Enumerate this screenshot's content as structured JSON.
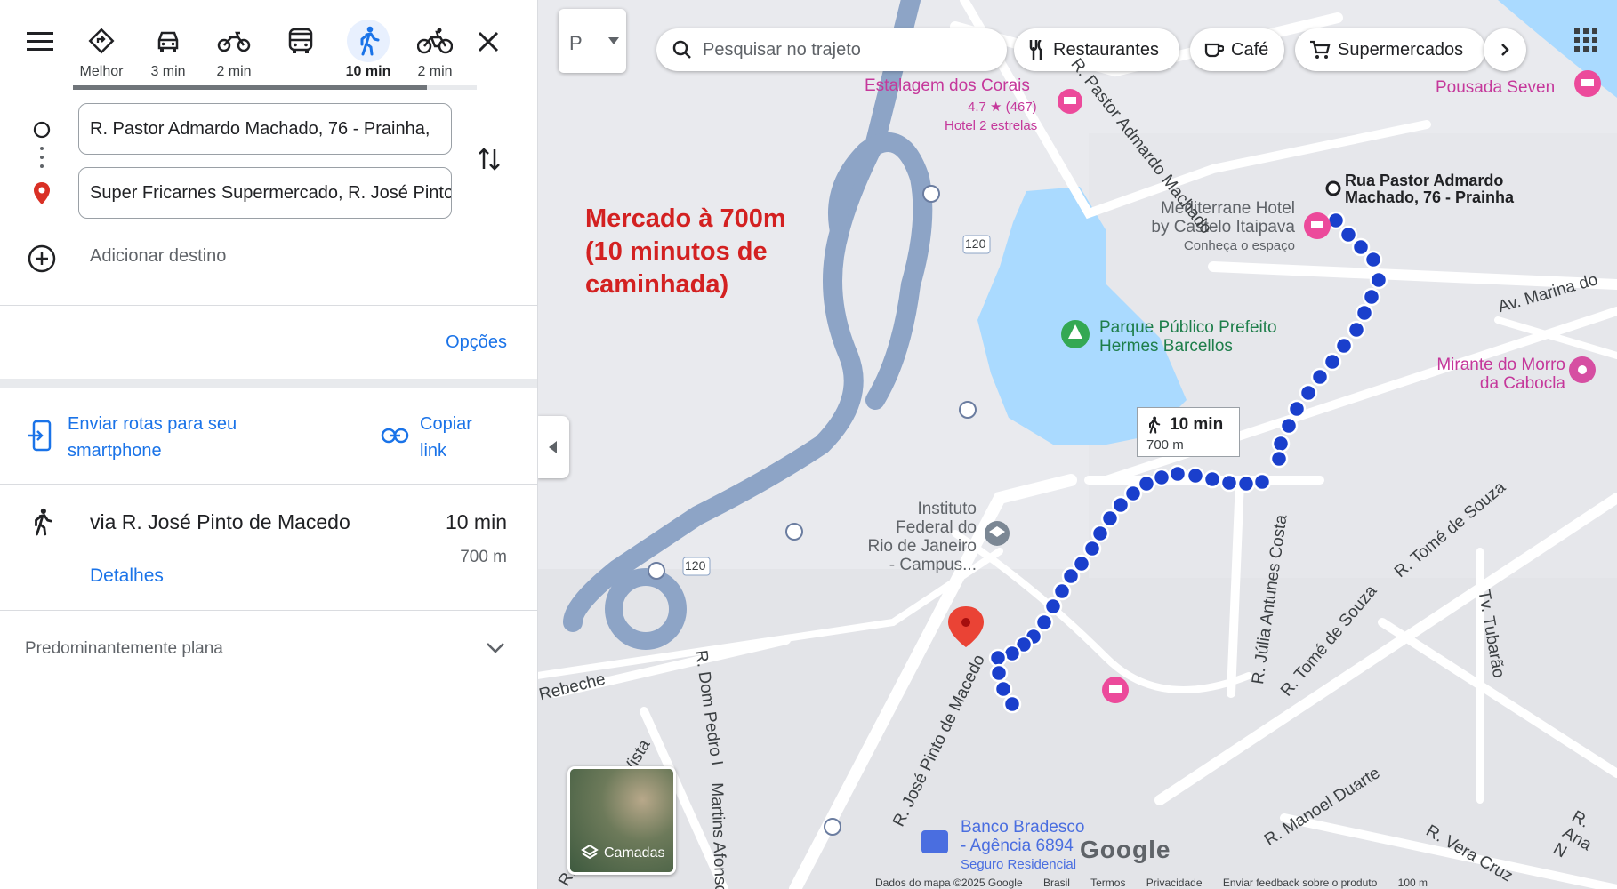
{
  "travel_modes": [
    {
      "name": "best",
      "label": "Melhor"
    },
    {
      "name": "car",
      "label": "3 min"
    },
    {
      "name": "motorcycle",
      "label": "2 min"
    },
    {
      "name": "transit",
      "label": ""
    },
    {
      "name": "walk",
      "label": "10 min",
      "active": true
    },
    {
      "name": "bike",
      "label": "2 min"
    }
  ],
  "origin": {
    "value": "R. Pastor Admardo Machado, 76 - Prainha,"
  },
  "destination": {
    "value": "Super Fricarnes Supermercado, R. José Pinto"
  },
  "add_destination": "Adicionar destino",
  "options_label": "Opções",
  "send_routes": "Enviar rotas para seu smartphone",
  "copy_link": "Copiar link",
  "route": {
    "via": "via R. José Pinto de Macedo",
    "time": "10 min",
    "distance": "700 m",
    "details": "Detalhes"
  },
  "terrain": "Predominantemente plana",
  "map": {
    "search_placeholder": "Pesquisar no trajeto",
    "chips": [
      "Restaurantes",
      "Café",
      "Supermercados"
    ],
    "annotation_line1": "Mercado à 700m",
    "annotation_line2": "(10 minutos de",
    "annotation_line3": "caminhada)",
    "route_badge_time": "10 min",
    "route_badge_distance": "700 m",
    "origin_label_1": "Rua Pastor Admardo",
    "origin_label_2": "Machado, 76 - Prainha",
    "places": {
      "estalagem": "Estalagem dos Corais",
      "estalagem_rating": "4.7 ★ (467)",
      "estalagem_type": "Hotel 2 estrelas",
      "mediterrane_1": "Mediterrane Hotel",
      "mediterrane_2": "by Castelo Itaipava",
      "mediterrane_sub": "Conheça o espaço",
      "pousada": "Pousada Seven",
      "parque_1": "Parque Público Prefeito",
      "parque_2": "Hermes Barcellos",
      "mirante_1": "Mirante do Morro",
      "mirante_2": "da Cabocla",
      "instituto_1": "Instituto",
      "instituto_2": "Federal do",
      "instituto_3": "Rio de Janeiro",
      "instituto_4": "- Campus...",
      "banco_1": "Banco Bradesco",
      "banco_2": "- Agência 6894",
      "banco_3": "Seguro Residencial",
      "layers": "Camadas"
    },
    "roads": {
      "r1": "R. Pastor Admardo Machado",
      "r2": "Av. Marina do",
      "r3": "R. Tomé de Souza",
      "r4": "R. Tomé de Souza",
      "r5": "R. Júlia Antunes Costa",
      "r6": "R. José Pinto de Macedo",
      "r7": "R. Dom Pedro I",
      "r8": "R. Morro da Boa Vista",
      "r9": "R. Manoel Duarte",
      "r10": "R. Vera Cruz",
      "r11": "Tv. Tubarão",
      "r12": "R. Ana N",
      "r13": "Martins Afonso",
      "r14": "Rebeche",
      "hw": "120"
    },
    "footer": [
      "Dados do mapa ©2025 Google",
      "Brasil",
      "Termos",
      "Privacidade",
      "Enviar feedback sobre o produto",
      "100 m"
    ],
    "google": "Google"
  }
}
